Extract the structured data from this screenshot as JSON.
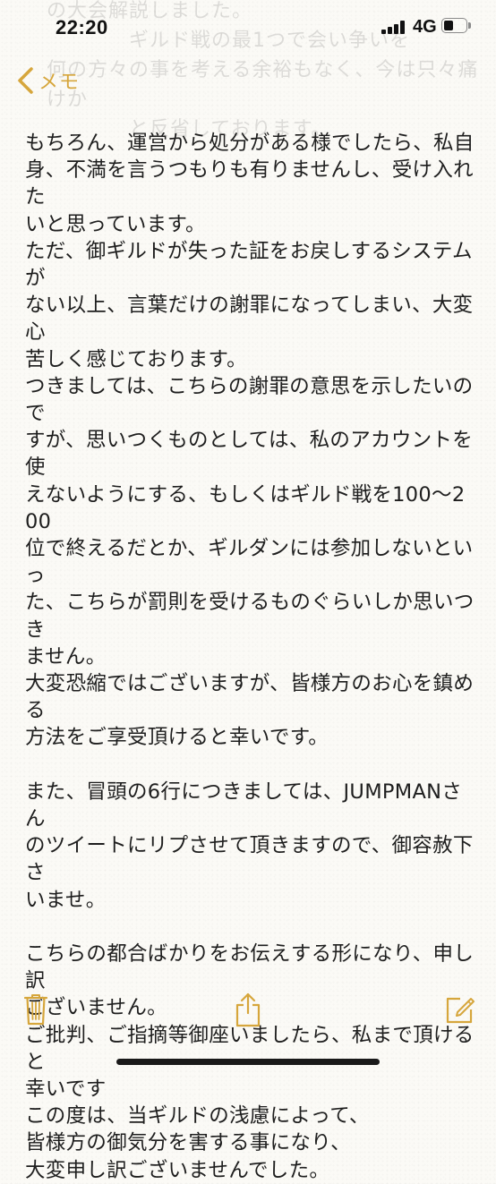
{
  "status_bar": {
    "time": "22:20",
    "network": "4G",
    "signal_icon": "cellular-signal-icon",
    "battery_icon": "battery-icon"
  },
  "nav": {
    "back_label": "メモ",
    "back_icon": "chevron-left-icon",
    "accent_color": "#d6a63c"
  },
  "ghost_text": "の大会解説しました。\n　　　　ギルド戦の最1つで会い争いを\n何の方々の事を考える余裕もなく、今は只々痛けか\n　　　　と反省しております。",
  "note": {
    "lines": [
      "もちろん、運営から処分がある様でしたら、私自",
      "身、不満を言うつもりも有りませんし、受け入れた",
      "いと思っています。",
      "ただ、御ギルドが失った証をお戻しするシステムが",
      "ない以上、言葉だけの謝罪になってしまい、大変心",
      "苦しく感じております。",
      "つきましては、こちらの謝罪の意思を示したいので",
      "すが、思いつくものとしては、私のアカウントを使",
      "えないようにする、もしくはギルド戦を100〜200",
      "位で終えるだとか、ギルダンには参加しないといっ",
      "た、こちらが罰則を受けるものぐらいしか思いつき",
      "ません。",
      "大変恐縮ではございますが、皆様方のお心を鎮める",
      "方法をご享受頂けると幸いです。",
      "",
      "また、冒頭の6行につきましては、JUMPMANさん",
      "のツイートにリプさせて頂きますので、御容赦下さ",
      "いませ。",
      "",
      "こちらの都合ばかりをお伝えする形になり、申し訳",
      "ございません。",
      "ご批判、ご指摘等御座いましたら、私まで頂けると",
      "幸いです",
      "この度は、当ギルドの浅慮によって、",
      "皆様方の御気分を害する事になり、",
      "大変申し訳ございませんでした。"
    ]
  },
  "toolbar": {
    "delete_icon": "trash-icon",
    "share_icon": "share-icon",
    "compose_icon": "compose-icon"
  }
}
